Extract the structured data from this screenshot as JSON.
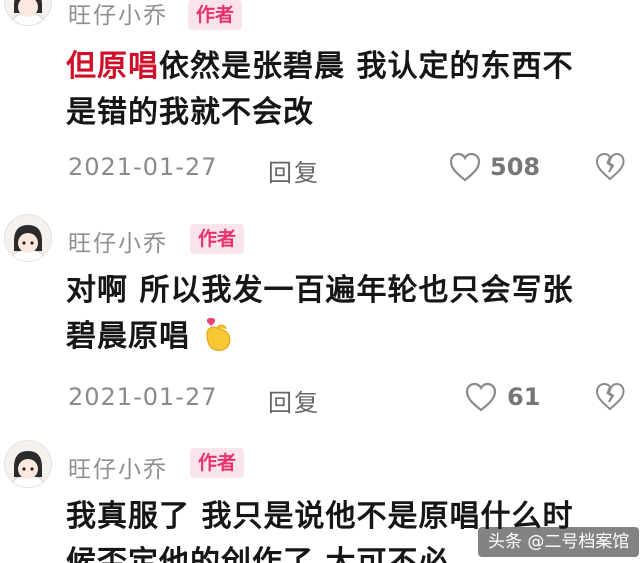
{
  "comments": [
    {
      "username": "旺仔小乔",
      "badge": "作者",
      "text_line1_highlight": "但原唱",
      "text_line1_rest": "依然是张碧晨 我认定的东西不",
      "text_line2": "是错的我就不会改",
      "date": "2021-01-27",
      "reply_label": "回复",
      "like_count": "508"
    },
    {
      "username": "旺仔小乔",
      "badge": "作者",
      "text_line1": "对啊 所以我发一百遍年轮也只会写张",
      "text_line2": "碧晨原唱",
      "emoji_name": "finger-heart-emoji",
      "date": "2021-01-27",
      "reply_label": "回复",
      "like_count": "61"
    },
    {
      "username": "旺仔小乔",
      "badge": "作者",
      "text_line1": "我真服了 我只是说他不是原唱什么时",
      "text_line2_partial": "候否定他的创作了 大可不必"
    }
  ],
  "watermark": "头条 @二号档案馆",
  "icons": {
    "like": "heart-outline-icon",
    "dislike": "broken-heart-icon"
  },
  "colors": {
    "badge_bg": "#fbe3ec",
    "badge_text": "#e6336b",
    "highlight": "#d0102a"
  }
}
